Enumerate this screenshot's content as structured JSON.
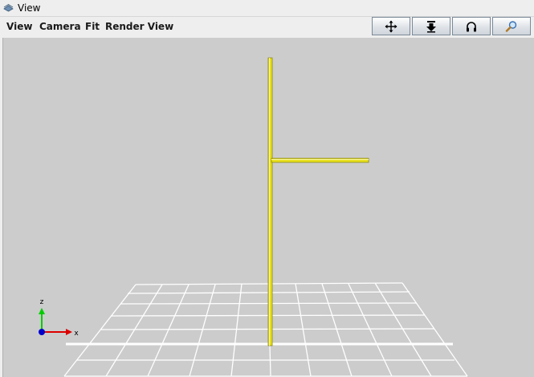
{
  "window": {
    "title": "View"
  },
  "menu": {
    "items": [
      "View",
      "Camera",
      "Fit",
      "Render View"
    ]
  },
  "toolbar": {
    "buttons": [
      {
        "name": "pan-button",
        "icon": "move-arrows-icon"
      },
      {
        "name": "zoom-extents-button",
        "icon": "arrow-down-icon"
      },
      {
        "name": "orbit-button",
        "icon": "headphones-icon"
      },
      {
        "name": "zoom-button",
        "icon": "magnifier-icon"
      }
    ]
  },
  "axes": {
    "z_label": "z",
    "x_label": "x",
    "z_color": "#00cc00",
    "x_color": "#dd0000",
    "y_color": "#0000cc"
  },
  "scene": {
    "background": "#cccccc",
    "grid_color": "#ffffff",
    "member_color": "#e8e01e"
  }
}
